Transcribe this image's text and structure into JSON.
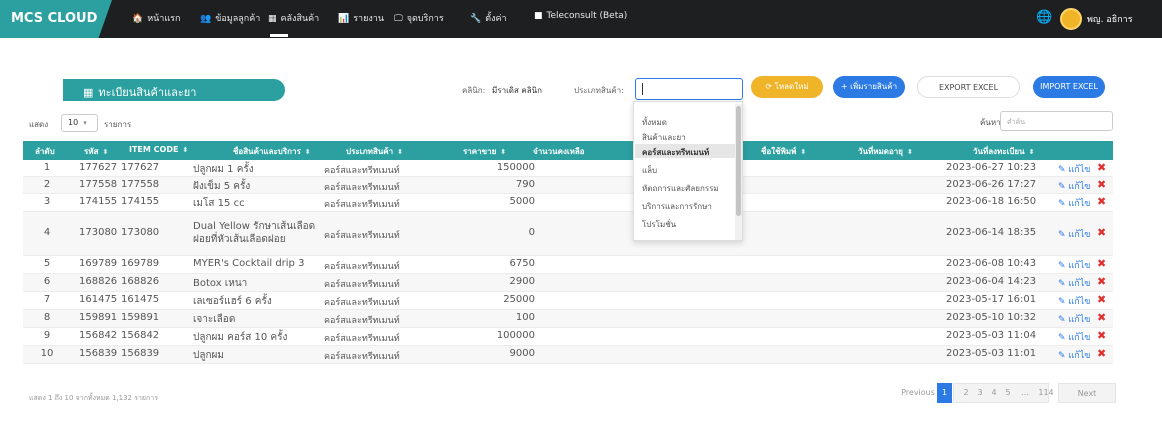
{
  "brand": "MCS CLOUD",
  "nav": [
    {
      "label": "หน้าแรก",
      "icon": "home-icon",
      "glyph": "🏠"
    },
    {
      "label": "ข้อมูลลูกค้า",
      "icon": "users-icon",
      "glyph": "👥"
    },
    {
      "label": "คลังสินค้า",
      "icon": "inventory-icon",
      "glyph": "▦"
    },
    {
      "label": "รายงาน",
      "icon": "chart-icon",
      "glyph": "📊"
    },
    {
      "label": "จุดบริการ",
      "icon": "monitor-icon",
      "glyph": "🖵"
    },
    {
      "label": "ตั้งค่า",
      "icon": "wrench-icon",
      "glyph": "🔧"
    },
    {
      "label": "Teleconsult (Beta)",
      "icon": "video-icon",
      "glyph": "■"
    }
  ],
  "user": {
    "name": "พญ. อธิการ"
  },
  "page_title": "ทะเบียนสินค้าและยา",
  "clinic": {
    "label": "คลินิก:",
    "value": "มีราเดิส คลินิก"
  },
  "product_type_label": "ประเภทสินค้า:",
  "buttons": {
    "reload": "โหลดใหม่",
    "add": "เพิ่มรายสินค้า",
    "export": "EXPORT EXCEL",
    "import": "IMPORT EXCEL"
  },
  "controls": {
    "show_label": "แสดง",
    "page_length": "10",
    "rows_label": "รายการ",
    "search_label": "ค้นหา",
    "search_placeholder": "คำค้น"
  },
  "dropdown_options": [
    "ทั้งหมด",
    "สินค้าและยา",
    "คอร์สและทรีทเมนท์",
    "แล็บ",
    "หัตถการและศัลยกรรม",
    "บริการและการรักษา",
    "โปรโมชั่น"
  ],
  "dropdown_selected": "คอร์สและทรีทเมนท์",
  "columns": [
    "ลำดับ",
    "รหัส",
    "ITEM CODE",
    "ชื่อสินค้าและบริการ",
    "ประเภทสินค้า",
    "ราคาขาย",
    "จำนวนคงเหลือ",
    "ชื่อใช้พิมพ์",
    "วันที่หมดอายุ",
    "วันที่ลงทะเบียน"
  ],
  "row_actions": {
    "edit": "แก้ไข",
    "edit_icon": "✎",
    "delete_icon": "✖"
  },
  "rows": [
    {
      "no": "1",
      "code": "177627",
      "item_code": "177627",
      "name": "ปลูกผม 1 ครั้ง",
      "type": "คอร์สและทรีทเมนท์",
      "price": "150000",
      "registered": "2023-06-27 10:23"
    },
    {
      "no": "2",
      "code": "177558",
      "item_code": "177558",
      "name": "ฝังเข็ม 5 ครั้ง",
      "type": "คอร์สและทรีทเมนท์",
      "price": "790",
      "registered": "2023-06-26 17:27"
    },
    {
      "no": "3",
      "code": "174155",
      "item_code": "174155",
      "name": "เมโส 15 cc",
      "type": "คอร์สและทรีทเมนท์",
      "price": "5000",
      "registered": "2023-06-18 16:50"
    },
    {
      "no": "4",
      "code": "173080",
      "item_code": "173080",
      "name": "Dual Yellow รักษาเส้นเลือดฝอยที่หัวเส้นเลือดฝอย",
      "name_line1": "Dual Yellow รักษาเส้นเลือด",
      "name_line2": "ฝอยที่หัวเส้นเลือดฝอย",
      "type": "คอร์สและทรีทเมนท์",
      "price": "0",
      "registered": "2023-06-14 18:35"
    },
    {
      "no": "5",
      "code": "169789",
      "item_code": "169789",
      "name": "MYER's Cocktail drip 3",
      "type": "คอร์สและทรีทเมนท์",
      "price": "6750",
      "registered": "2023-06-08 10:43"
    },
    {
      "no": "6",
      "code": "168826",
      "item_code": "168826",
      "name": "Botox เหนา",
      "type": "คอร์สและทรีทเมนท์",
      "price": "2900",
      "registered": "2023-06-04 14:23"
    },
    {
      "no": "7",
      "code": "161475",
      "item_code": "161475",
      "name": "เลเซอร์แฮร์ 6 ครั้ง",
      "type": "คอร์สและทรีทเมนท์",
      "price": "25000",
      "registered": "2023-05-17 16:01"
    },
    {
      "no": "8",
      "code": "159891",
      "item_code": "159891",
      "name": "เจาะเลือด",
      "type": "คอร์สและทรีทเมนท์",
      "price": "100",
      "registered": "2023-05-10 10:32"
    },
    {
      "no": "9",
      "code": "156842",
      "item_code": "156842",
      "name": "ปลูกผม คอร์ส 10 ครั้ง",
      "type": "คอร์สและทรีทเมนท์",
      "price": "100000",
      "registered": "2023-05-03 11:04"
    },
    {
      "no": "10",
      "code": "156839",
      "item_code": "156839",
      "name": "ปลูกผม",
      "type": "คอร์สและทรีทเมนท์",
      "price": "9000",
      "registered": "2023-05-03 11:01"
    }
  ],
  "footer_info": "แสดง 1 ถึง 10 จากทั้งหมด 1,132 รายการ",
  "pagination": {
    "previous": "Previous",
    "pages": [
      "1",
      "2",
      "3",
      "4",
      "5",
      "…",
      "114"
    ],
    "current": "1",
    "next": "Next"
  },
  "colors": {
    "teal": "#2ca0a0",
    "blue": "#2c7be5",
    "amber": "#f0b429",
    "red": "#e03131",
    "navbar": "#1e1f21"
  }
}
